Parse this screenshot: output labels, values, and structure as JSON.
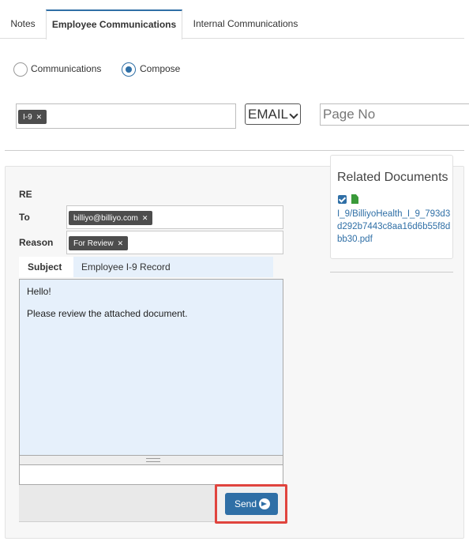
{
  "tabs": [
    {
      "label": "Notes",
      "active": false
    },
    {
      "label": "Employee Communications",
      "active": true
    },
    {
      "label": "Internal Communications",
      "active": false
    }
  ],
  "mode": {
    "options": [
      {
        "label": "Communications",
        "selected": false
      },
      {
        "label": "Compose",
        "selected": true
      }
    ]
  },
  "filters": {
    "tags": [
      "I-9"
    ],
    "type_selected": "EMAIL",
    "page_no_placeholder": "Page No"
  },
  "compose": {
    "re_label": "RE",
    "to_label": "To",
    "to_chips": [
      "billiyo@billiyo.com"
    ],
    "reason_label": "Reason",
    "reason_chips": [
      "For Review"
    ],
    "subject_label": "Subject",
    "subject_value": "Employee I-9 Record",
    "body_lines": [
      "Hello!",
      "Please review the attached document."
    ],
    "send_label": "Send"
  },
  "related_documents": {
    "title": "Related Documents",
    "items": [
      {
        "checked": true,
        "file": "I_9/BilliyoHealth_I_9_793d3d292b7443c8aa16d6b55f8dbb30.pdf"
      }
    ]
  },
  "colors": {
    "accent": "#2f6fa6",
    "highlight": "#e0443e",
    "chip": "#4d4d4d",
    "editor_bg": "#e6f0fb"
  }
}
